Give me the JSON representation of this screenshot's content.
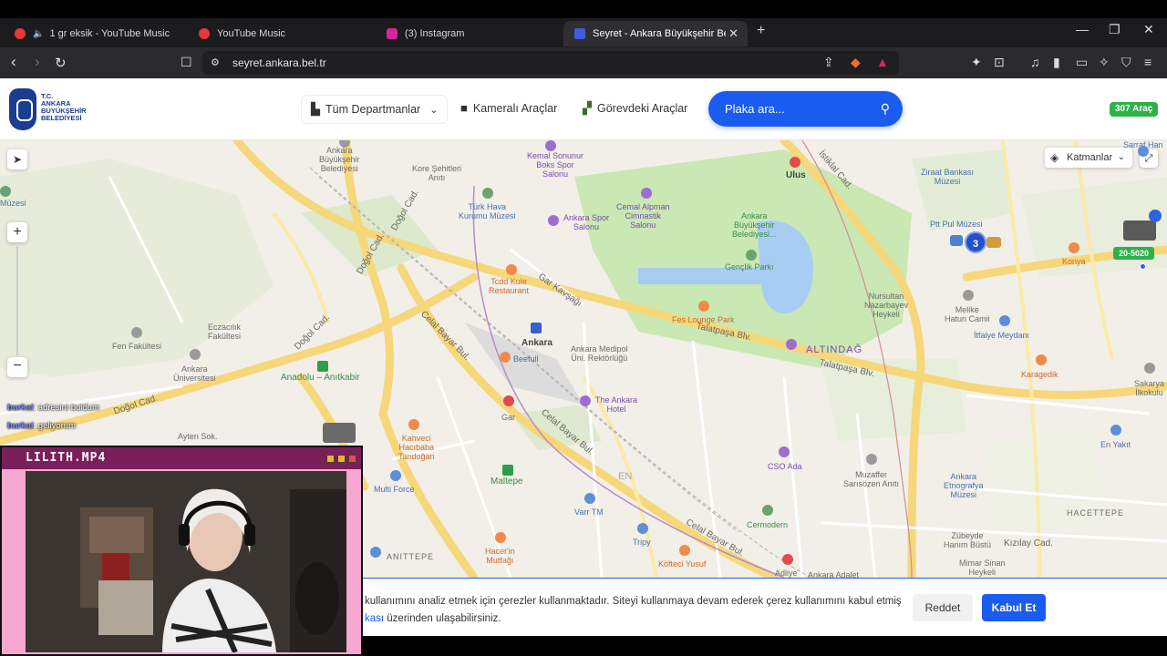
{
  "browser": {
    "tabs": [
      {
        "title": "1 gr eksik - YouTube Music",
        "color": "#e53935"
      },
      {
        "title": "YouTube Music",
        "color": "#e53935"
      },
      {
        "title": "(3) Instagram",
        "color": "#d6249f"
      },
      {
        "title": "Seyret - Ankara Büyükşehir Beled",
        "color": "#3e5bd8"
      }
    ],
    "url": "seyret.ankara.bel.tr",
    "icons": [
      "back-icon",
      "forward-icon",
      "reload-icon",
      "bookmark-icon",
      "share-icon",
      "brave-shield-icon",
      "extensions-icon"
    ]
  },
  "header": {
    "logo_lines": [
      "T.C.",
      "ANKARA",
      "BÜYÜKŞEHİR",
      "BELEDİYESİ"
    ],
    "departments_label": "Tüm Departmanlar",
    "camera_vehicles_label": "Kameralı Araçlar",
    "on_duty_vehicles_label": "Görevdeki Araçlar",
    "search_placeholder": "Plaka ara...",
    "vehicle_count": "307 Araç"
  },
  "map": {
    "layers_label": "Katmanlar",
    "cluster_count": "3",
    "plate_label": "20-5020",
    "labels": {
      "ankara_bb": "Ankara\nBüyükşehir\nBelediyesi",
      "kore": "Kore Şehitleri\nAnıtı",
      "kemal": "Kemal Sonunur\nBoks Spor\nSalonu",
      "ulus": "Ulus",
      "ziraat": "Ziraat Bankası\nMüzesi",
      "turk_hava": "Türk Hava\nKurumu Müzesi",
      "cemal": "Cemal Alpman\nCimnastik\nSalonu",
      "ankara_spor": "Ankara Spor\nSalonu",
      "abb_park": "Ankara\nBüyükşehir\nBelediyesi...",
      "genclik": "Gençlik Parkı",
      "ptt": "Ptt Pul Müzesi",
      "tcdd": "Tcdd Kule\nRestaurant",
      "fes": "Fes Lounge Park",
      "nursultan": "Nursultan\nNazarbayev\nHeykeli",
      "melike": "Melike\nHatun Camii",
      "itfaiye": "İtfaiye Meydanı",
      "konya": "Konya",
      "eczacilik": "Eczacılık\nFakültesi",
      "fen": "Fen Fakültesi",
      "ankara_univ": "Ankara\nÜniversitesi",
      "anadolu": "Anadolu – Anıtkabir",
      "ankara_station": "Ankara",
      "beefull": "Beefull",
      "medipol": "Ankara Medipol\nÜni. Rektörlüğü",
      "ankara_hotel": "The Ankara\nHotel",
      "altindag": "ALTINDAĞ",
      "karagedik": "Karagedik",
      "ilkokul": "Sakarya\nİlkokulu",
      "gar": "Gar",
      "kahveci": "Kahveci\nHacıbaba\nTandoğan",
      "multiforce": "Multi Force",
      "maltepe": "Maltepe",
      "varr": "Varr TM",
      "cso": "CSO Ada",
      "muzaffer": "Muzaffer\nSarısözen Anıtı",
      "etnografya": "Ankara\nEtnografya\nMüzesi",
      "hacettepe": "HACETTEPE",
      "enyakit": "En Yakıt",
      "cermodern": "Cermodern",
      "tripy": "Tripy",
      "hacerin": "Hacer'in\nMutfağı",
      "kofteci": "Köfteci Yusuf",
      "zubeyde": "Zübeyde\nHanım Büstü",
      "kizilay": "Kızılay Cad.",
      "mimar": "Mimar Sinan\nHeykeli",
      "adliye": "Adliye",
      "anittepe": "ANITTEPE",
      "talatpasa1": "Talatpaşa Blv.",
      "talatpasa2": "Talatpaşa Blv.",
      "celal1": "Celal Bayar Bul.",
      "celal2": "Celal Bayar Bul.",
      "celal3": "Celal Bayar Bul.",
      "dogol1": "Doğol Cad.",
      "dogol2": "Doğol Cad.",
      "dogol3": "Doğol Cad.",
      "dogol4": "Doğol Cad.",
      "istiklal": "İstiklal Cad.",
      "gar_kavsagi": "Gar Kavşağı",
      "ayten": "Ayten Sok.",
      "muzesi_left": "Müzesi",
      "sarraf": "Sarraf Han",
      "adliye_adalet": "Ankara Adalet",
      "en": "EN"
    }
  },
  "chat": [
    {
      "user": "burkai",
      "message": ": adresini buldum"
    },
    {
      "user": "burkai",
      "message": ": geliyorum"
    }
  ],
  "cookie": {
    "text": "kullanımını analiz etmek için çerezler kullanmaktadır. Siteyi kullanmaya devam ederek çerez kullanımını kabul etmiş",
    "link_text": "kası",
    "text_after_link": " üzerinden ulaşabilirsiniz.",
    "reject_label": "Reddet",
    "accept_label": "Kabul Et"
  },
  "webcam": {
    "title": "LILITH.MP4"
  }
}
